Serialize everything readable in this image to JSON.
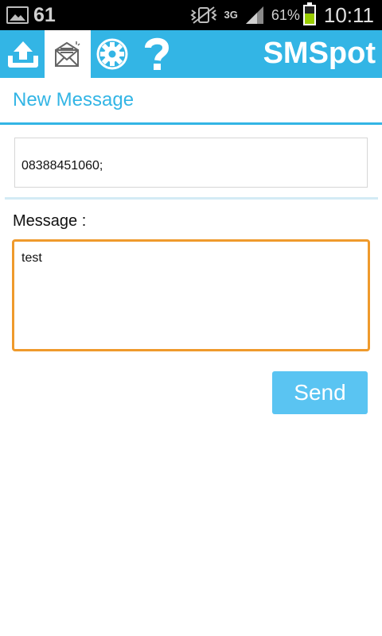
{
  "status_bar": {
    "notification_count": "61",
    "network_type": "3G",
    "battery_percent": "61%",
    "battery_level": 0.61,
    "time": "10:11"
  },
  "action_bar": {
    "brand": "SMSpot",
    "icons": [
      "upload-icon",
      "envelope-icon",
      "gear-icon",
      "help-icon"
    ],
    "accent_color": "#33b5e5"
  },
  "page": {
    "title": "New Message"
  },
  "recipient": {
    "value": "08388451060;"
  },
  "message": {
    "label": "Message :",
    "value": "test",
    "focus_color": "#ef9a2c"
  },
  "send_button": {
    "label": "Send"
  }
}
